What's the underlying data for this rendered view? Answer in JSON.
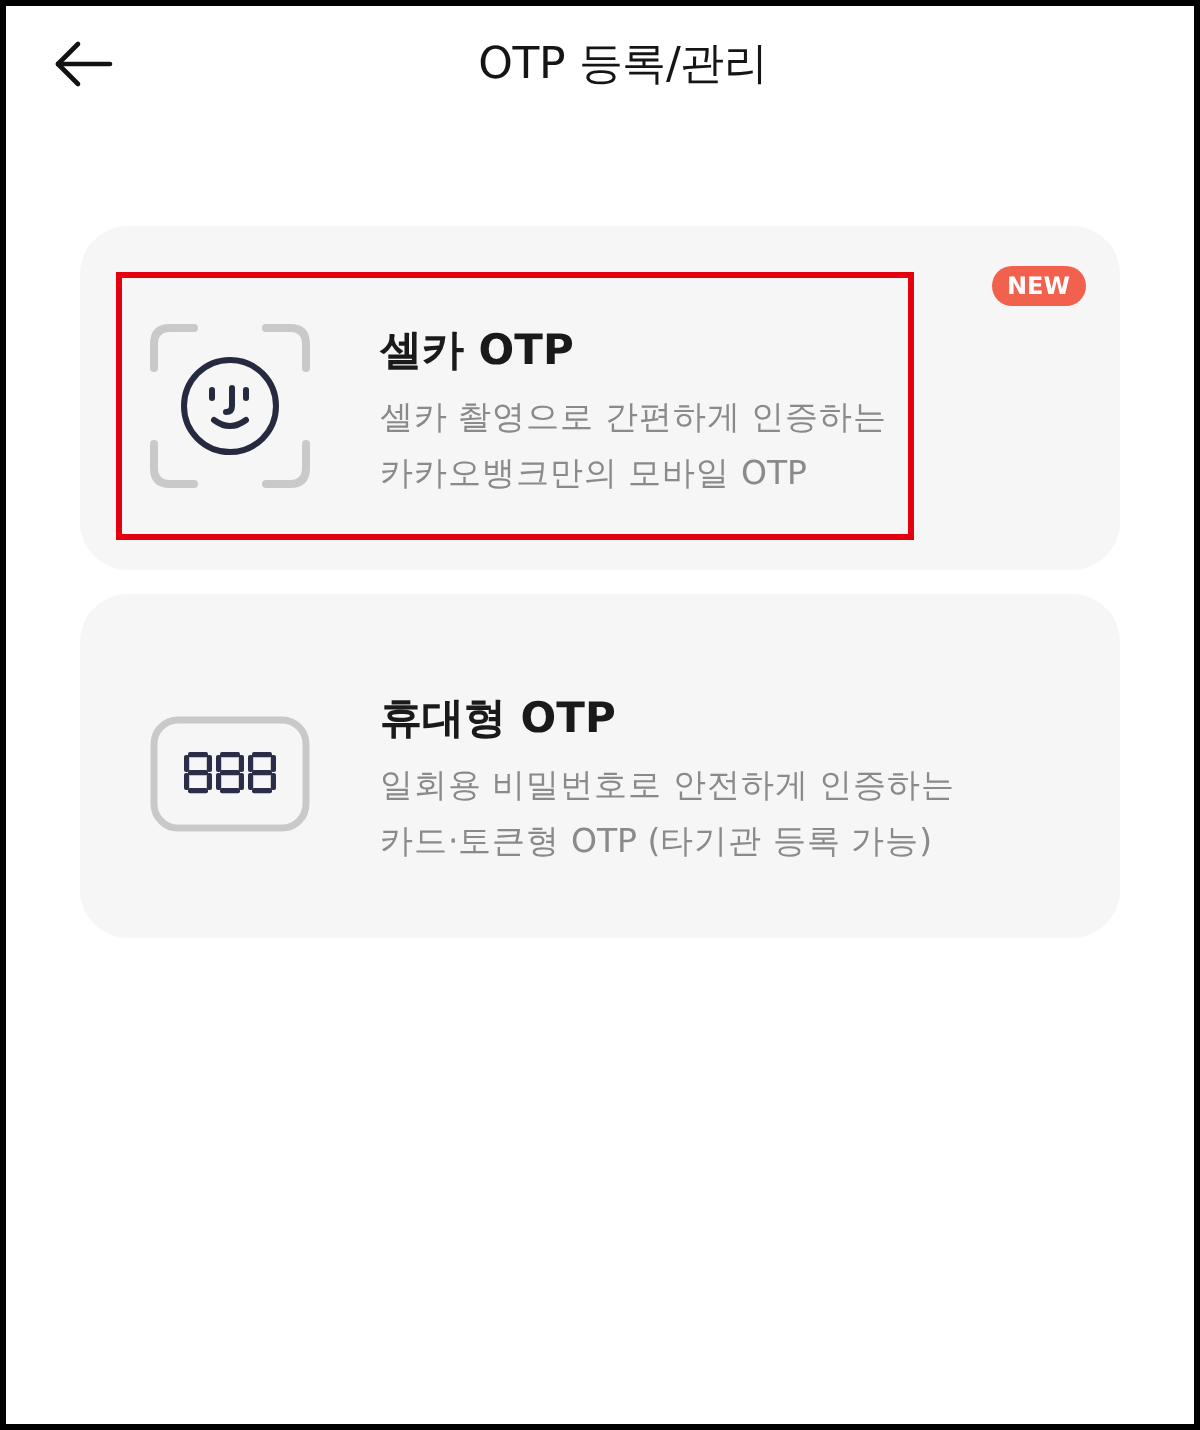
{
  "header": {
    "title": "OTP 등록/관리"
  },
  "options": [
    {
      "kind": "selfie",
      "title": "셀카 OTP",
      "description": [
        "셀카 촬영으로 간편하게 인증하는",
        "카카오뱅크만의 모바일 OTP"
      ],
      "badge": "NEW",
      "highlighted": true
    },
    {
      "kind": "token",
      "title": "휴대형 OTP",
      "description": [
        "일회용 비밀번호로 안전하게 인증하는",
        "카드·토큰형 OTP (타기관 등록 가능)"
      ],
      "highlighted": false
    }
  ]
}
